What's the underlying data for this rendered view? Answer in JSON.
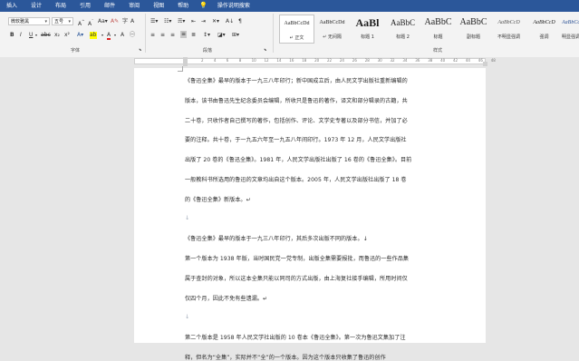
{
  "tabs": [
    "插入",
    "设计",
    "布局",
    "引用",
    "邮件",
    "审阅",
    "视图",
    "帮助",
    "操作说明搜索"
  ],
  "ribbon": {
    "font_name": "微软雅黑",
    "font_size": "五号",
    "font_group_label": "字体",
    "para_group_label": "段落",
    "styles_group_label": "样式",
    "styles": [
      {
        "preview": "AaBbCcDd",
        "name": "↵ 正文"
      },
      {
        "preview": "AaBbCcDd",
        "name": "↵ 无间隔"
      },
      {
        "preview": "AaBl",
        "name": "标题 1"
      },
      {
        "preview": "AaBbC",
        "name": "标题 2"
      },
      {
        "preview": "AaBbC",
        "name": "标题"
      },
      {
        "preview": "AaBbC",
        "name": "副标题"
      },
      {
        "preview": "AaBbCcD",
        "name": "不明显强调"
      },
      {
        "preview": "AaBbCcD",
        "name": "强调"
      },
      {
        "preview": "AaBbCcD",
        "name": "明显强调"
      }
    ]
  },
  "ruler_numbers": [
    "2",
    "4",
    "6",
    "8",
    "10",
    "12",
    "14",
    "16",
    "18",
    "20",
    "22",
    "24",
    "26",
    "28",
    "30",
    "32",
    "34",
    "36",
    "38",
    "40",
    "42",
    "44",
    "46",
    "48"
  ],
  "document": {
    "lines": [
      "《鲁迅全集》最早的版本于一九三八年印行；新中国成立后，由人民文学出版社重新编辑的",
      "版本，该书由鲁迅先生纪念委员会编辑，所收只是鲁迅的著作，译文和部分辑录的古籍，共",
      "二十卷，只收作者自己撰写的著作，包括创作、评论、文学史专著以及部分书信，并加了必",
      "要的注释。共十卷，于一九五六年至一九五八年间印行。1973 年 12 月，人民文学出版社",
      "出版了 20 卷的《鲁迅全集》。1981 年，人民文学出版社出版了 16 卷的《鲁迅全集》。目前",
      "一般教科书所选用的鲁迅的文章均出自这个版本。2005 年，人民文学出版社出版了 18 卷",
      "的《鲁迅全集》新版本。↵",
      "↓",
      "《鲁迅全集》最早的版本于一九三八年印行，其后多次出版不同的版本。↓",
      "第一个版本为 1938 年版，当时国民党一党专制，出版全集需要报批，而鲁迅的一些作品集",
      "属于查封的对象，所以这本全集只能以同司的方式出版，由上海复社接手编辑，所用时间仅",
      "仅四个月，因此不免有些遗漏。↵",
      "↓",
      "第二个版本是 1958 年人民文学社出版的 10 卷本《鲁迅全集》。第一次为鲁迅文集加了注",
      "释，但名为“全集”，实际并不“全”的一个版本。因为这个版本只收集了鲁迅的创作"
    ]
  }
}
